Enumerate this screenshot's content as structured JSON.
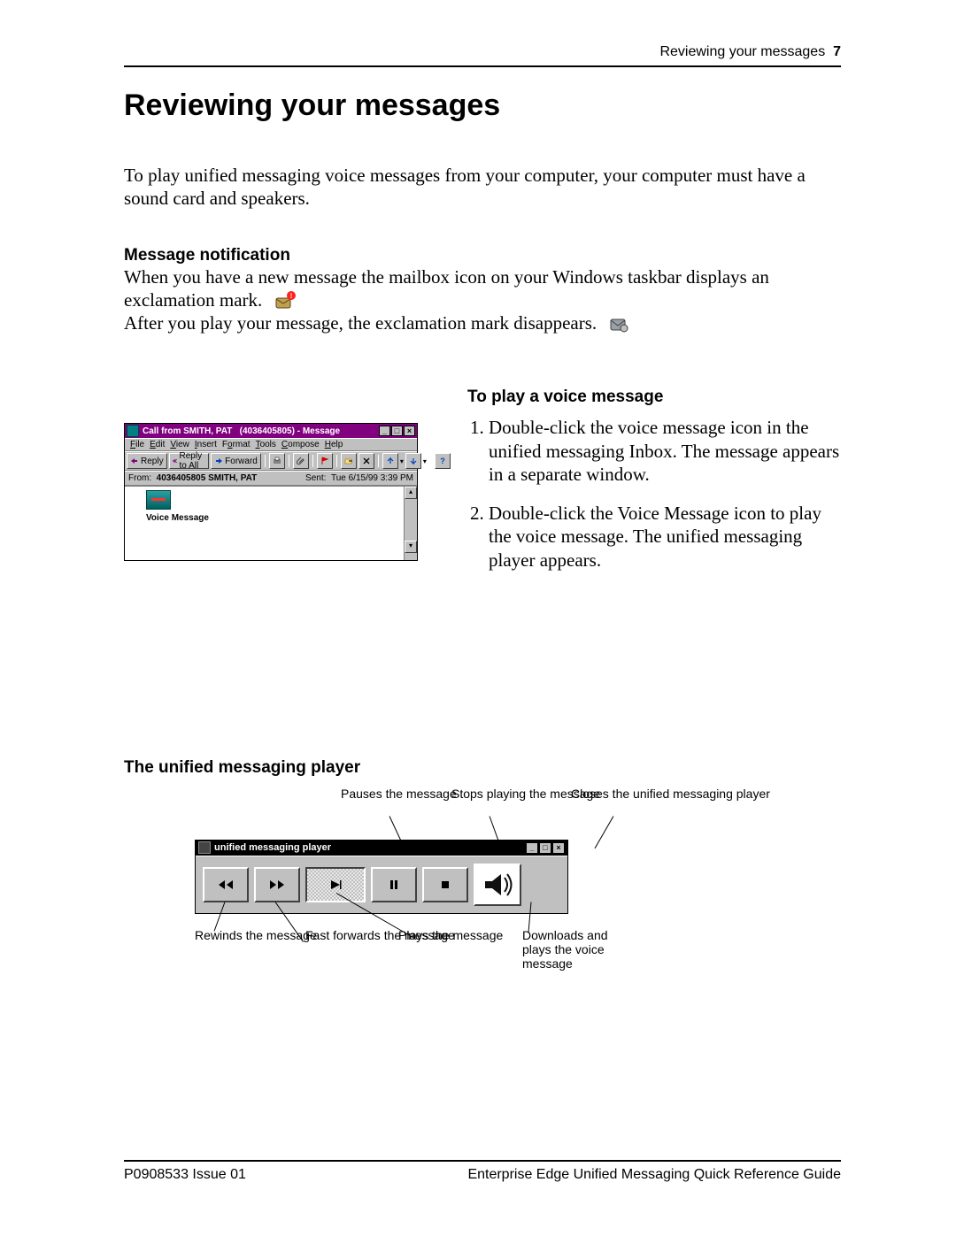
{
  "header": {
    "running_head": "Reviewing your messages",
    "page_number": "7"
  },
  "title": "Reviewing your messages",
  "intro": "To play unified messaging voice messages from your computer, your computer must have a sound card and speakers.",
  "section1": {
    "heading": "Message notification",
    "line1": "When you have a new message the mailbox icon on your Windows taskbar displays an exclamation mark.",
    "line2": "After you play your message, the exclamation mark disappears."
  },
  "section2": {
    "heading": "To play a voice message",
    "steps": [
      "Double-click the voice message icon in the unified messaging Inbox. The message appears in a separate window.",
      "Double-click the Voice Message icon to play the voice message. The unified messaging player appears."
    ]
  },
  "msg_window": {
    "title_prefix": "Call from",
    "caller": "SMITH, PAT",
    "number_in_title": "(4036405805)",
    "title_suffix": "- Message",
    "menus": [
      "File",
      "Edit",
      "View",
      "Insert",
      "Format",
      "Tools",
      "Compose",
      "Help"
    ],
    "toolbar": {
      "reply": "Reply",
      "reply_all": "Reply to All",
      "forward": "Forward"
    },
    "from_label": "From:",
    "from_value": "4036405805 SMITH, PAT",
    "sent_label": "Sent:",
    "sent_value": "Tue 6/15/99 3:39 PM",
    "voice_message_label": "Voice Message"
  },
  "player_section": {
    "heading": "The unified messaging player"
  },
  "player": {
    "title": "unified messaging player",
    "annotations": {
      "pause": "Pauses the message",
      "stop": "Stops playing the message",
      "close": "Closes the unified messaging player",
      "rewind": "Rewinds the message",
      "ffwd": "Fast forwards the message",
      "play": "Plays the message",
      "download": "Downloads and plays the voice message"
    }
  },
  "footer": {
    "left": "P0908533 Issue 01",
    "right": "Enterprise Edge Unified Messaging Quick Reference Guide"
  }
}
